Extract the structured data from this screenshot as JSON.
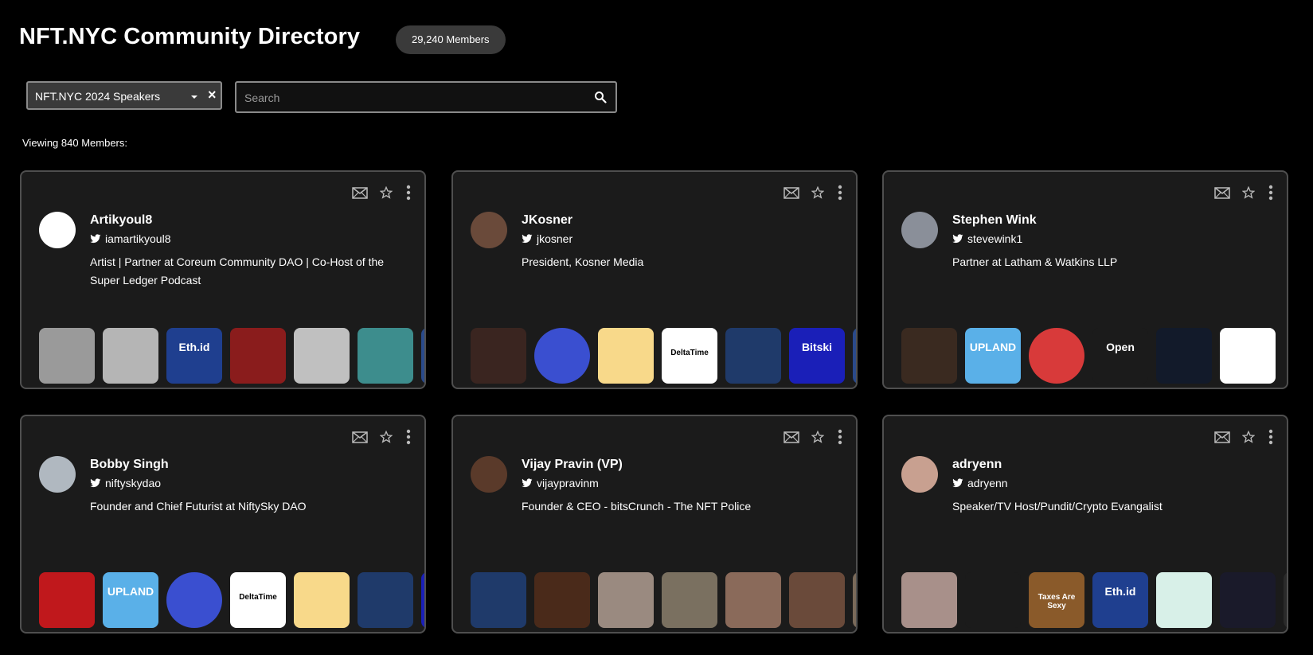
{
  "header": {
    "title": "NFT.NYC Community Directory",
    "members_badge": "29,240 Members"
  },
  "filters": {
    "selected": "NFT.NYC 2024 Speakers",
    "clear_glyph": "×",
    "search_placeholder": "Search"
  },
  "viewing_text": "Viewing 840 Members:",
  "colors": {
    "background": "#000000",
    "card": "#1b1b1b",
    "card_border": "#4f4f4f",
    "badge": "#3a3a3a"
  },
  "cards": [
    {
      "name": "Artikyoul8",
      "handle": "iamartikyoul8",
      "bio": "Artist | Partner at Coreum Community DAO | Co-Host of the Super Ledger Podcast",
      "avatar_color": "#ffffff",
      "nfts": [
        {
          "color": "#9a9a9a",
          "label": ""
        },
        {
          "color": "#b5b5b5",
          "label": ""
        },
        {
          "color": "#1f3f8f",
          "label": "Eth.id"
        },
        {
          "color": "#8a1c1c",
          "label": ""
        },
        {
          "color": "#c0c0c0",
          "label": ""
        },
        {
          "color": "#3d8d8d",
          "label": ""
        },
        {
          "color": "#2a4a8a",
          "label": ""
        }
      ]
    },
    {
      "name": "JKosner",
      "handle": "jkosner",
      "bio": "President, Kosner Media",
      "avatar_color": "#6a4a3a",
      "nfts": [
        {
          "color": "#3a2520",
          "label": ""
        },
        {
          "color": "#3a4fd0",
          "label": "",
          "round": true
        },
        {
          "color": "#f8d98a",
          "label": ""
        },
        {
          "color": "#ffffff",
          "label": "DeltaTime"
        },
        {
          "color": "#1f3a6a",
          "label": ""
        },
        {
          "color": "#1a1fb8",
          "label": "Bitski"
        },
        {
          "color": "#2a4a8a",
          "label": ""
        }
      ]
    },
    {
      "name": "Stephen Wink",
      "handle": "stevewink1",
      "bio": "Partner at Latham & Watkins LLP",
      "avatar_color": "#8a8f99",
      "nfts": [
        {
          "color": "#3a2a20",
          "label": ""
        },
        {
          "color": "#5ab0e8",
          "label": "UPLAND"
        },
        {
          "color": "#d83a3a",
          "label": "",
          "round": true
        },
        {
          "color": "#1b1b1b",
          "label": "Open"
        },
        {
          "color": "#121a2a",
          "label": ""
        },
        {
          "color": "#ffffff",
          "label": ""
        }
      ]
    },
    {
      "name": "Bobby Singh",
      "handle": "niftyskydao",
      "bio": "Founder and Chief Futurist at NiftySky DAO",
      "avatar_color": "#b0b8c0",
      "nfts": [
        {
          "color": "#c0181c",
          "label": ""
        },
        {
          "color": "#5ab0e8",
          "label": "UPLAND"
        },
        {
          "color": "#3a4fd0",
          "label": "",
          "round": true
        },
        {
          "color": "#ffffff",
          "label": "DeltaTime"
        },
        {
          "color": "#f8d98a",
          "label": ""
        },
        {
          "color": "#1f3a6a",
          "label": ""
        },
        {
          "color": "#1a1fb8",
          "label": ""
        }
      ]
    },
    {
      "name": "Vijay Pravin (VP)",
      "handle": "vijaypravinm",
      "bio": "Founder & CEO - bitsCrunch - The NFT Police",
      "avatar_color": "#5a3a2a",
      "nfts": [
        {
          "color": "#1f3a6a",
          "label": ""
        },
        {
          "color": "#4a2a1a",
          "label": ""
        },
        {
          "color": "#9a8a80",
          "label": ""
        },
        {
          "color": "#7a7060",
          "label": ""
        },
        {
          "color": "#8a6a5a",
          "label": ""
        },
        {
          "color": "#6a4a3a",
          "label": ""
        },
        {
          "color": "#7a6a5a",
          "label": ""
        }
      ]
    },
    {
      "name": "adryenn",
      "handle": "adryenn",
      "bio": "Speaker/TV Host/Pundit/Crypto Evangalist",
      "avatar_color": "#c8a090",
      "nfts": [
        {
          "color": "#a8908a",
          "label": ""
        },
        {
          "color": "#1b1b1b",
          "label": ""
        },
        {
          "color": "#8a5a2a",
          "label": "Taxes Are Sexy"
        },
        {
          "color": "#1f3f8f",
          "label": "Eth.id"
        },
        {
          "color": "#d8f0e8",
          "label": ""
        },
        {
          "color": "#1a1a2a",
          "label": ""
        },
        {
          "color": "#2a2a2a",
          "label": ""
        }
      ]
    }
  ]
}
